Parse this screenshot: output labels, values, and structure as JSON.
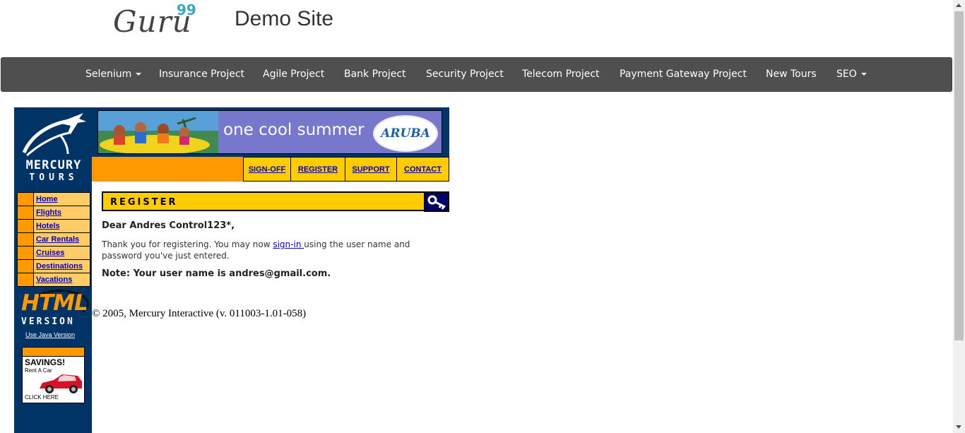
{
  "header": {
    "logo_text": "Guru",
    "logo_superscript": "99",
    "site_title": "Demo Site"
  },
  "navbar": {
    "items": [
      {
        "label": "Selenium",
        "has_dropdown": true
      },
      {
        "label": "Insurance Project",
        "has_dropdown": false
      },
      {
        "label": "Agile Project",
        "has_dropdown": false
      },
      {
        "label": "Bank Project",
        "has_dropdown": false
      },
      {
        "label": "Security Project",
        "has_dropdown": false
      },
      {
        "label": "Telecom Project",
        "has_dropdown": false
      },
      {
        "label": "Payment Gateway Project",
        "has_dropdown": false
      },
      {
        "label": "New Tours",
        "has_dropdown": false
      },
      {
        "label": "SEO",
        "has_dropdown": true
      }
    ]
  },
  "mercury": {
    "brand_line1": "MERCURY",
    "brand_line2": "TOURS",
    "side_menu": [
      "Home",
      "Flights",
      "Hotels",
      "Car Rentals",
      "Cruises",
      "Destinations",
      "Vacations"
    ],
    "html_logo": "HTML",
    "version_text": "VERSION",
    "java_link": "Use Java Version",
    "savings": {
      "title": "SAVINGS!",
      "subtitle": "Rent A Car",
      "cta": "CLICK HERE"
    }
  },
  "banner": {
    "text": "one cool summer",
    "brand": "ARUBA"
  },
  "top_links": [
    "SIGN-OFF",
    "REGISTER",
    "SUPPORT",
    "CONTACT"
  ],
  "register": {
    "title": "REGISTER",
    "greeting": "Dear Andres Control123*,",
    "thanks_before": "Thank you for registering. You may now ",
    "sign_in_link": "sign-in ",
    "thanks_after": "using the user name and password you've just entered.",
    "note": "Note: Your user name is andres@gmail.com."
  },
  "footer": {
    "copyright": "© 2005, Mercury Interactive (v. 011003-1.01-058)"
  },
  "colors": {
    "navbar_bg": "#4f4f4f",
    "mercury_navy": "#003366",
    "mercury_orange": "#ff9900",
    "mercury_yellow": "#ffcc00",
    "link_blue": "#0000cc",
    "guru_accent": "#3aa7c4"
  }
}
